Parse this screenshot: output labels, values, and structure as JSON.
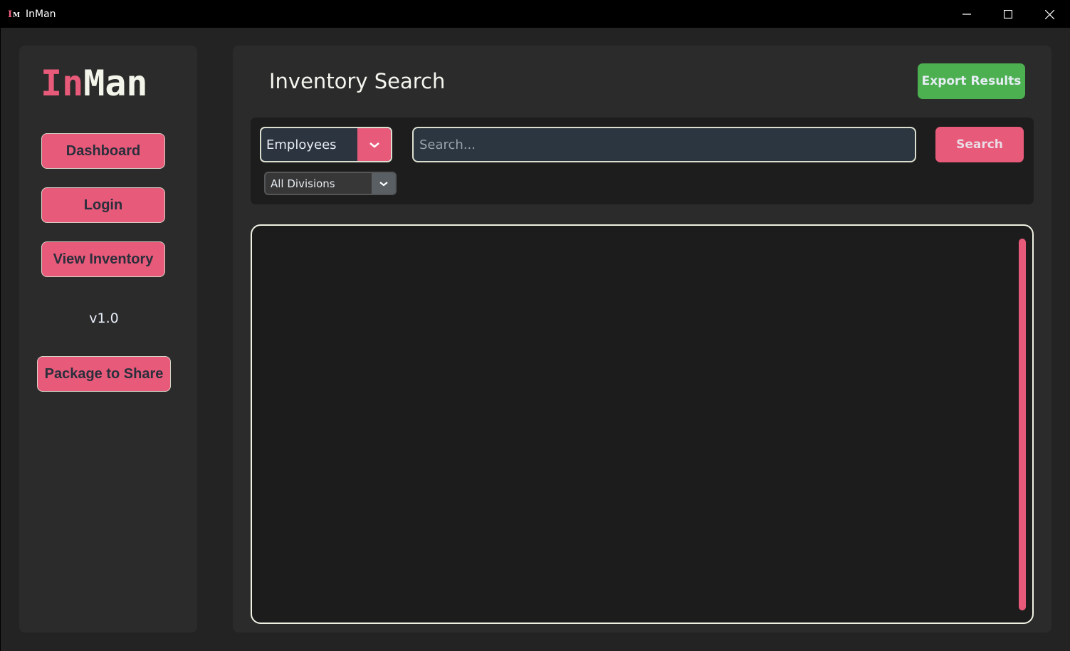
{
  "window": {
    "title": "InMan",
    "icon": "inman-app-icon",
    "icon_letters": {
      "first": "I",
      "second": "M"
    },
    "controls": [
      "minimize-icon",
      "maximize-icon",
      "close-icon"
    ]
  },
  "sidebar": {
    "logo": {
      "part1": "In",
      "part2": "Man"
    },
    "items": [
      {
        "label": "Dashboard"
      },
      {
        "label": "Login"
      },
      {
        "label": "View Inventory"
      }
    ],
    "version": "v1.0",
    "package_button": "Package to Share"
  },
  "main": {
    "title": "Inventory Search",
    "export_button": "Export Results",
    "search": {
      "category_selected": "Employees",
      "division_selected": "All Divisions",
      "input_value": "",
      "input_placeholder": "Search...",
      "button_label": "Search"
    },
    "results": []
  },
  "colors": {
    "accent": "#e85a7a",
    "export_green": "#4caf50",
    "panel": "#2b2b2b",
    "background": "#232323"
  }
}
